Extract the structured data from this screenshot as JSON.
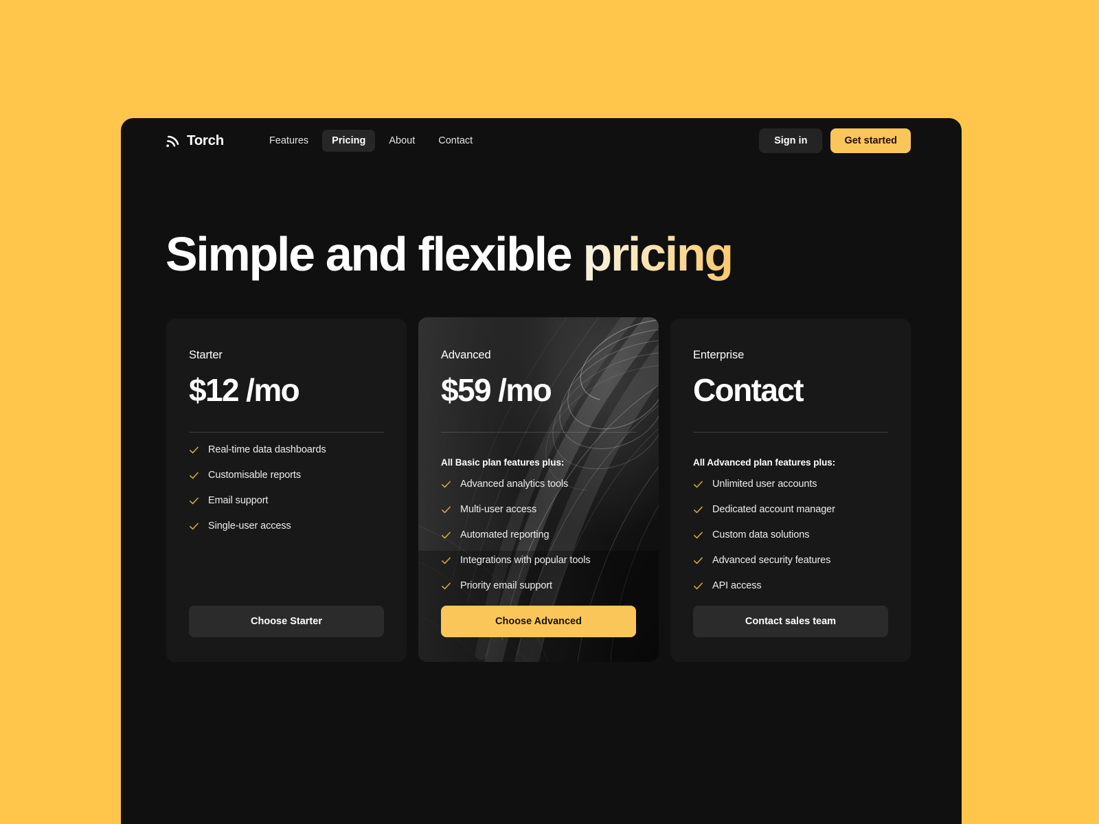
{
  "theme": {
    "page_background": "#FFC64B",
    "panel_background": "#101010",
    "card_background": "#181818",
    "featured_card_background": "#2A2A2A",
    "accent": "#FBC659",
    "check_color": "#D9A441",
    "text_primary": "#FFFFFF"
  },
  "nav": {
    "brand": "Torch",
    "brand_icon": "signal-arc-icon",
    "links": [
      {
        "label": "Features",
        "active": false
      },
      {
        "label": "Pricing",
        "active": true
      },
      {
        "label": "About",
        "active": false
      },
      {
        "label": "Contact",
        "active": false
      }
    ],
    "sign_in_label": "Sign in",
    "get_started_label": "Get started"
  },
  "hero": {
    "title_plain": "Simple and flexible ",
    "title_accent": "pricing"
  },
  "plans": [
    {
      "name": "Starter",
      "price": "$12",
      "period": "/mo",
      "features_note": "",
      "features": [
        "Real-time data dashboards",
        "Customisable reports",
        "Email support",
        "Single-user access"
      ],
      "cta_label": "Choose Starter",
      "cta_style": "dark",
      "featured": false
    },
    {
      "name": "Advanced",
      "price": "$59",
      "period": "/mo",
      "features_note": "All Basic plan features plus:",
      "features": [
        "Advanced analytics tools",
        "Multi-user access",
        "Automated reporting",
        "Integrations with popular tools",
        "Priority email support"
      ],
      "cta_label": "Choose Advanced",
      "cta_style": "primary",
      "featured": true
    },
    {
      "name": "Enterprise",
      "price": "Contact",
      "period": "",
      "features_note": "All Advanced plan features plus:",
      "features": [
        "Unlimited user accounts",
        "Dedicated account manager",
        "Custom data solutions",
        "Advanced security features",
        "API access"
      ],
      "cta_label": "Contact sales team",
      "cta_style": "dark",
      "featured": false
    }
  ]
}
